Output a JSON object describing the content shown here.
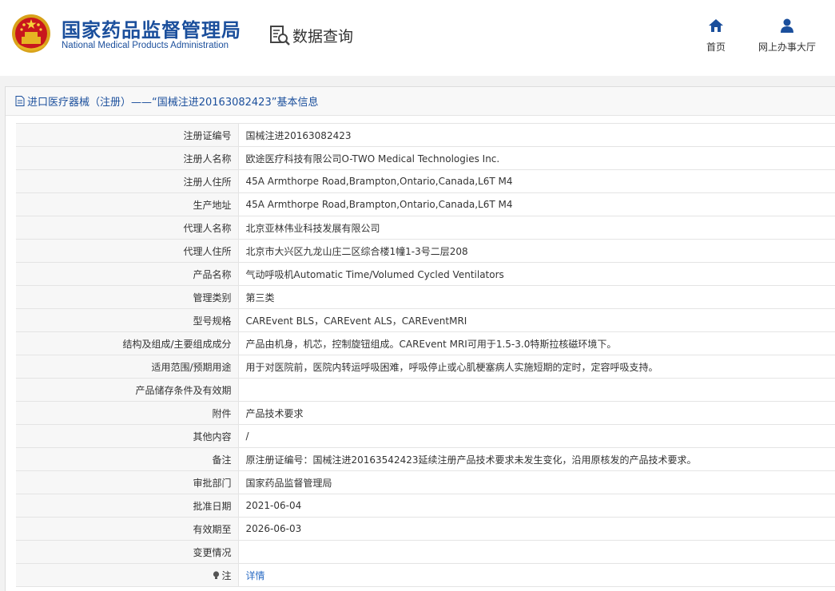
{
  "header": {
    "brand_cn": "国家药品监督管理局",
    "brand_en": "National Medical Products Administration",
    "query_label": "数据查询",
    "nav": [
      {
        "label": "首页",
        "icon": "home-icon"
      },
      {
        "label": "网上办事大厅",
        "icon": "user-icon"
      }
    ],
    "brand_color": "#1b4f9c"
  },
  "panel": {
    "title": "进口医疗器械（注册）——“国械注进20163082423”基本信息",
    "rows": [
      {
        "label": "注册证编号",
        "value": "国械注进20163082423"
      },
      {
        "label": "注册人名称",
        "value": "欧途医疗科技有限公司O-TWO Medical Technologies Inc."
      },
      {
        "label": "注册人住所",
        "value": "45A Armthorpe Road,Brampton,Ontario,Canada,L6T M4"
      },
      {
        "label": "生产地址",
        "value": "45A Armthorpe Road,Brampton,Ontario,Canada,L6T M4"
      },
      {
        "label": "代理人名称",
        "value": "北京亚林伟业科技发展有限公司"
      },
      {
        "label": "代理人住所",
        "value": "北京市大兴区九龙山庄二区综合楼1幢1-3号二层208"
      },
      {
        "label": "产品名称",
        "value": "气动呼吸机Automatic Time/Volumed Cycled Ventilators"
      },
      {
        "label": "管理类别",
        "value": "第三类"
      },
      {
        "label": "型号规格",
        "value": "CAREvent BLS，CAREvent ALS，CAREventMRI"
      },
      {
        "label": "结构及组成/主要组成成分",
        "value": "产品由机身，机芯，控制旋钮组成。CAREvent MRI可用于1.5-3.0特斯拉核磁环境下。"
      },
      {
        "label": "适用范围/预期用途",
        "value": "用于对医院前，医院内转运呼吸困难，呼吸停止或心肌梗塞病人实施短期的定时，定容呼吸支持。"
      },
      {
        "label": "产品储存条件及有效期",
        "value": ""
      },
      {
        "label": "附件",
        "value": "产品技术要求"
      },
      {
        "label": "其他内容",
        "value": "/"
      },
      {
        "label": "备注",
        "value": "原注册证编号：国械注进20163542423延续注册产品技术要求未发生变化，沿用原核发的产品技术要求。"
      },
      {
        "label": "审批部门",
        "value": "国家药品监督管理局"
      },
      {
        "label": "批准日期",
        "value": "2021-06-04"
      },
      {
        "label": "有效期至",
        "value": "2026-06-03"
      },
      {
        "label": "变更情况",
        "value": ""
      }
    ],
    "note_row": {
      "label": "注",
      "link": "详情",
      "icon": "bulb-icon"
    },
    "link_color": "#2b6cc4"
  }
}
